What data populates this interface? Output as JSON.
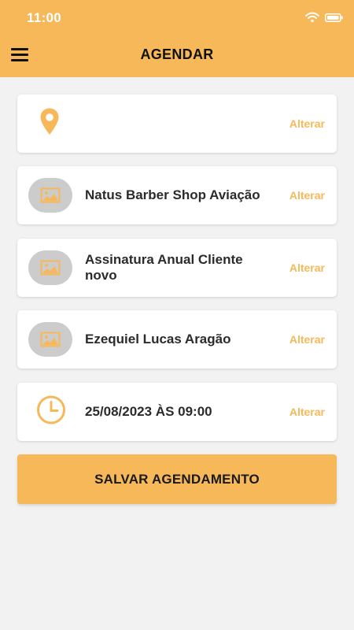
{
  "status_bar": {
    "time": "11:00"
  },
  "header": {
    "title": "AGENDAR"
  },
  "cards": {
    "location": {
      "text": "",
      "action": "Alterar"
    },
    "shop": {
      "text": "Natus Barber Shop Aviação",
      "action": "Alterar"
    },
    "service": {
      "text": "Assinatura Anual Cliente novo",
      "action": "Alterar"
    },
    "professional": {
      "text": "Ezequiel Lucas Aragão",
      "action": "Alterar"
    },
    "datetime": {
      "text": "25/08/2023 ÀS 09:00",
      "action": "Alterar"
    }
  },
  "save_button": {
    "label": "SALVAR AGENDAMENTO"
  },
  "colors": {
    "accent": "#f7b859",
    "background": "#f2f2f2",
    "card": "#ffffff",
    "thumb": "#cccccc"
  }
}
